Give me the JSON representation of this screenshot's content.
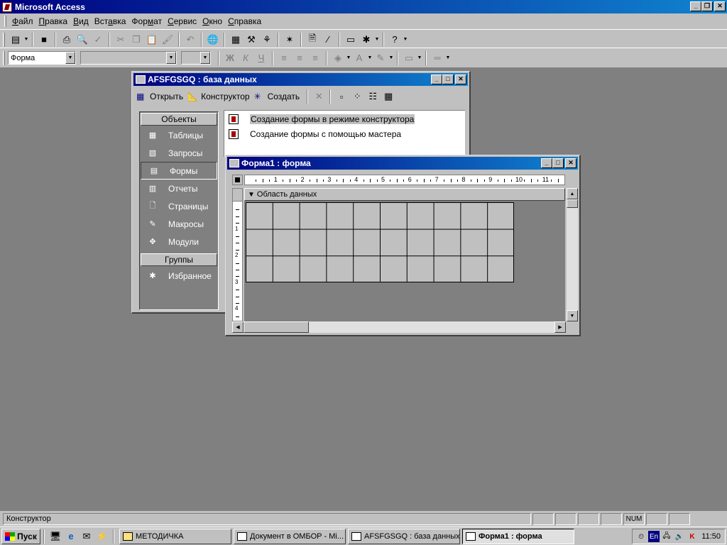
{
  "app": {
    "title": "Microsoft Access",
    "buttons": {
      "minimize": "_",
      "restore": "❐",
      "close": "✕"
    }
  },
  "menubar": {
    "items": [
      {
        "pre": "",
        "key": "Ф",
        "post": "айл"
      },
      {
        "pre": "",
        "key": "П",
        "post": "равка"
      },
      {
        "pre": "",
        "key": "В",
        "post": "ид"
      },
      {
        "pre": "Вст",
        "key": "а",
        "post": "вка"
      },
      {
        "pre": "Фор",
        "key": "м",
        "post": "ат"
      },
      {
        "pre": "",
        "key": "С",
        "post": "ервис"
      },
      {
        "pre": "",
        "key": "О",
        "post": "кно"
      },
      {
        "pre": "",
        "key": "С",
        "post": "правка"
      }
    ]
  },
  "formatting_toolbar": {
    "object_combo": "Форма",
    "font_combo": "",
    "size_combo": "",
    "bold": "Ж",
    "italic": "К",
    "underline": "Ч"
  },
  "db_window": {
    "title": "AFSFGSGQ : база данных",
    "toolbar": {
      "open": "Открыть",
      "design": "Конструктор",
      "create": "Создать"
    },
    "objects_header": "Объекты",
    "objects": [
      {
        "label": "Таблицы",
        "icon": "table-icon"
      },
      {
        "label": "Запросы",
        "icon": "query-icon"
      },
      {
        "label": "Формы",
        "icon": "form-icon"
      },
      {
        "label": "Отчеты",
        "icon": "report-icon"
      },
      {
        "label": "Страницы",
        "icon": "page-icon"
      },
      {
        "label": "Макросы",
        "icon": "macro-icon"
      },
      {
        "label": "Модули",
        "icon": "module-icon"
      }
    ],
    "selected_object": "Формы",
    "groups_header": "Группы",
    "groups": [
      {
        "label": "Избранное",
        "icon": "favorites-icon"
      }
    ],
    "list": [
      "Создание формы в режиме конструктора",
      "Создание формы с помощью мастера"
    ]
  },
  "form_window": {
    "title": "Форма1 : форма",
    "section": "Область данных",
    "ruler_numbers": [
      "1",
      "2",
      "3",
      "4",
      "5",
      "6",
      "7",
      "8",
      "9",
      "10",
      "11",
      "1"
    ],
    "vruler_numbers": [
      "1",
      "2",
      "3",
      "4"
    ]
  },
  "statusbar": {
    "text": "Конструктор",
    "num": "NUM"
  },
  "taskbar": {
    "start": "Пуск",
    "tasks": [
      {
        "label": "МЕТОДИЧКА",
        "active": false
      },
      {
        "label": "Документ в ОМБОР - Mi...",
        "active": false
      },
      {
        "label": "AFSFGSGQ : база данных",
        "active": false
      },
      {
        "label": "Форма1 : форма",
        "active": true
      }
    ],
    "lang": "En",
    "clock": "11:50"
  }
}
